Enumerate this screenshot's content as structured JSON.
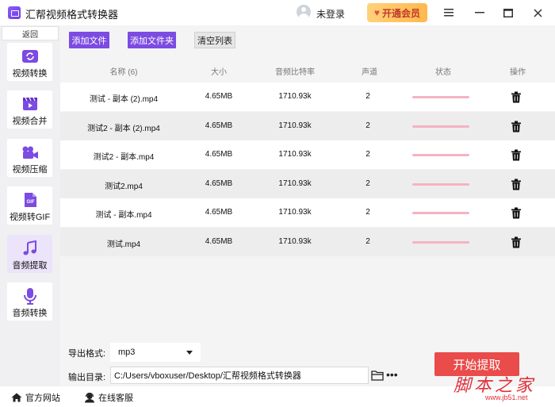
{
  "app": {
    "title": "汇帮视频格式转换器",
    "login_text": "未登录",
    "vip_label": "开通会员",
    "window_controls": [
      "menu-icon",
      "minimize-icon",
      "maximize-icon",
      "close-icon"
    ]
  },
  "sidebar": {
    "back_label": "返回",
    "items": [
      {
        "label": "视频转换",
        "icon": "video-convert-icon",
        "active": false
      },
      {
        "label": "视频合并",
        "icon": "video-merge-icon",
        "active": false
      },
      {
        "label": "视频压缩",
        "icon": "video-compress-icon",
        "active": false
      },
      {
        "label": "视频转GIF",
        "icon": "gif-icon",
        "active": false
      },
      {
        "label": "音频提取",
        "icon": "music-note-icon",
        "active": true
      },
      {
        "label": "音频转换",
        "icon": "microphone-icon",
        "active": false
      }
    ]
  },
  "toolbar": {
    "add_file": "添加文件",
    "add_folder": "添加文件夹",
    "clear_list": "清空列表"
  },
  "table": {
    "headers": {
      "name": "名称 (6)",
      "size": "大小",
      "bitrate": "音频比特率",
      "channels": "声道",
      "status": "状态",
      "action": "操作"
    },
    "rows": [
      {
        "name": "测试 - 副本 (2).mp4",
        "size": "4.65MB",
        "bitrate": "1710.93k",
        "channels": "2",
        "progress": 0
      },
      {
        "name": "测试2 - 副本 (2).mp4",
        "size": "4.65MB",
        "bitrate": "1710.93k",
        "channels": "2",
        "progress": 0
      },
      {
        "name": "测试2 - 副本.mp4",
        "size": "4.65MB",
        "bitrate": "1710.93k",
        "channels": "2",
        "progress": 0
      },
      {
        "name": "测试2.mp4",
        "size": "4.65MB",
        "bitrate": "1710.93k",
        "channels": "2",
        "progress": 0
      },
      {
        "name": "测试 - 副本.mp4",
        "size": "4.65MB",
        "bitrate": "1710.93k",
        "channels": "2",
        "progress": 0
      },
      {
        "name": "测试.mp4",
        "size": "4.65MB",
        "bitrate": "1710.93k",
        "channels": "2",
        "progress": 0
      }
    ]
  },
  "output": {
    "format_label": "导出格式:",
    "format_value": "mp3",
    "dir_label": "输出目录:",
    "dir_value": "C:/Users/vboxuser/Desktop/汇帮视频格式转换器",
    "more": "•••",
    "start_label": "开始提取"
  },
  "statusbar": {
    "website": "官方网站",
    "support": "在线客服"
  },
  "watermark": {
    "main": "脚本之家",
    "sub": "www.jb51.net"
  },
  "colors": {
    "accent": "#7c4be2",
    "start": "#ea4b4b",
    "vip": "#ffb84d",
    "progress": "#f4b3c3"
  }
}
